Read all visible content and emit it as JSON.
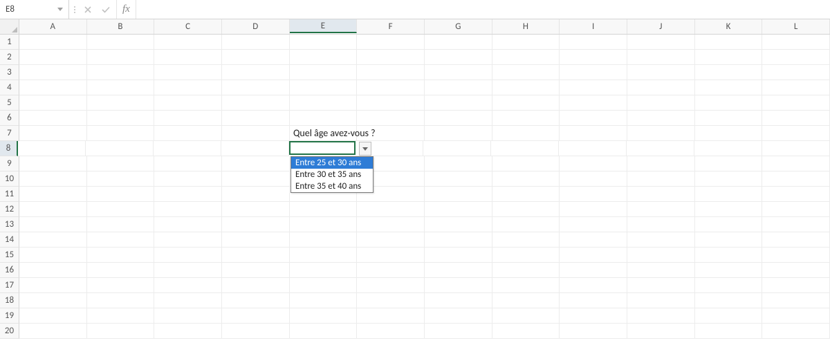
{
  "formula_bar": {
    "name_box": "E8",
    "fx_label": "fx",
    "formula_value": ""
  },
  "columns": [
    "A",
    "B",
    "C",
    "D",
    "E",
    "F",
    "G",
    "H",
    "I",
    "J",
    "K",
    "L"
  ],
  "selected_column": "E",
  "rows": [
    "1",
    "2",
    "3",
    "4",
    "5",
    "6",
    "7",
    "8",
    "9",
    "10",
    "11",
    "12",
    "13",
    "14",
    "15",
    "16",
    "17",
    "18",
    "19",
    "20"
  ],
  "selected_row": "8",
  "active_cell": {
    "col": "E",
    "row": "8",
    "value": ""
  },
  "cells": {
    "E7": "Quel âge avez-vous ?"
  },
  "dropdown": {
    "attached_to": "E8",
    "open": true,
    "options": [
      "Entre 25 et 30 ans",
      "Entre 30 et 35 ans",
      "Entre 35 et 40 ans"
    ],
    "highlighted_index": 0
  }
}
